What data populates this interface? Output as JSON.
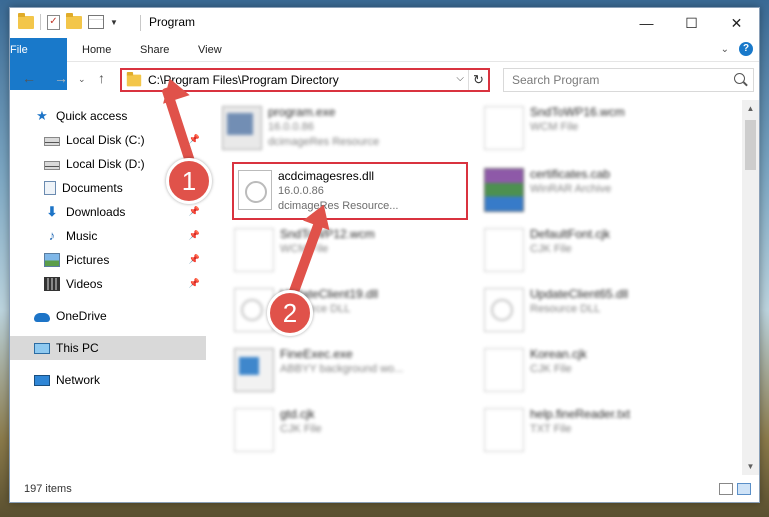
{
  "window": {
    "title": "Program",
    "controls": {
      "minimize": "—",
      "maximize": "☐",
      "close": "✕"
    }
  },
  "ribbon": {
    "tabs": [
      "File",
      "Home",
      "Share",
      "View"
    ]
  },
  "address_bar": {
    "path": "C:\\Program Files\\Program Directory",
    "refresh": "↻",
    "dropdown": "⌵"
  },
  "search": {
    "placeholder": "Search Program"
  },
  "nav_buttons": {
    "back": "←",
    "forward": "→",
    "up": "↑"
  },
  "sidebar": {
    "items": [
      {
        "label": "Quick access",
        "icon": "star-icon",
        "pinned": false
      },
      {
        "label": "Local Disk (C:)",
        "icon": "disk-icon",
        "pinned": true
      },
      {
        "label": "Local Disk (D:)",
        "icon": "disk-icon",
        "pinned": false
      },
      {
        "label": "Documents",
        "icon": "documents-icon",
        "pinned": true
      },
      {
        "label": "Downloads",
        "icon": "download-icon",
        "pinned": true
      },
      {
        "label": "Music",
        "icon": "music-icon",
        "pinned": true
      },
      {
        "label": "Pictures",
        "icon": "pictures-icon",
        "pinned": true
      },
      {
        "label": "Videos",
        "icon": "videos-icon",
        "pinned": true
      },
      {
        "label": "OneDrive",
        "icon": "onedrive-icon",
        "pinned": false
      },
      {
        "label": "This PC",
        "icon": "pc-icon",
        "pinned": false,
        "selected": true
      },
      {
        "label": "Network",
        "icon": "network-icon",
        "pinned": false
      }
    ]
  },
  "files": {
    "left": [
      {
        "name": "program.exe",
        "line2": "16.0.0.86",
        "line3": "dcimageRes Resource",
        "icon": "exe-file-icon",
        "blurred": true
      },
      {
        "name": "acdcimagesres.dll",
        "line2": "16.0.0.86",
        "line3": "dcimageRes Resource...",
        "icon": "dll-file-icon",
        "blurred": false,
        "highlighted": true
      },
      {
        "name": "SndToWP12.wcm",
        "line2": "WCM File",
        "line3": "",
        "icon": "blank-file-icon",
        "blurred": true
      },
      {
        "name": "UpdateClient19.dll",
        "line2": "Resource DLL",
        "line3": "",
        "icon": "dll-file-icon",
        "blurred": true
      },
      {
        "name": "FineExec.exe",
        "line2": "ABBYY background wo...",
        "line3": "",
        "icon": "app-file-icon",
        "blurred": true
      },
      {
        "name": "gtd.cjk",
        "line2": "CJK File",
        "line3": "",
        "icon": "blank-file-icon",
        "blurred": true
      }
    ],
    "right": [
      {
        "name": "SndToWP16.wcm",
        "line2": "WCM File",
        "icon": "blank-file-icon",
        "blurred": true
      },
      {
        "name": "certificates.cab",
        "line2": "WinRAR Archive",
        "icon": "rar-file-icon",
        "blurred": true
      },
      {
        "name": "DefaultFont.cjk",
        "line2": "CJK File",
        "icon": "blank-file-icon",
        "blurred": true
      },
      {
        "name": "UpdateClient65.dll",
        "line2": "Resource DLL",
        "icon": "dll-file-icon",
        "blurred": true
      },
      {
        "name": "Korean.cjk",
        "line2": "CJK File",
        "icon": "blank-file-icon",
        "blurred": true
      },
      {
        "name": "help.fineReader.txt",
        "line2": "TXT File",
        "icon": "blank-file-icon",
        "blurred": true
      }
    ]
  },
  "status": {
    "item_count": "197 items"
  },
  "annotations": {
    "step1": "1",
    "step2": "2"
  },
  "colors": {
    "accent": "#1979ca",
    "highlight_red": "#d9333f",
    "badge_red": "#e0524a"
  }
}
